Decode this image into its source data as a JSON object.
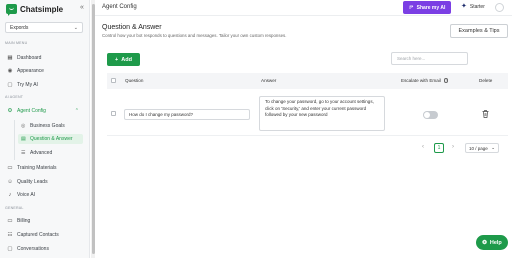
{
  "app": {
    "name": "Chatsimple",
    "brand_color": "#1e9a4a",
    "accent_color": "#7b3fe4"
  },
  "sidebar": {
    "workspace": "Expords",
    "sections": {
      "main_menu": "MAIN MENU",
      "ai_agent": "AI AGENT",
      "general": "GENERAL"
    },
    "main_items": [
      {
        "label": "Dashboard",
        "icon": "grid-icon"
      },
      {
        "label": "Appearance",
        "icon": "eye-icon"
      },
      {
        "label": "Try My AI",
        "icon": "chat-icon"
      }
    ],
    "agent_config": {
      "label": "Agent Config",
      "icon": "gear-icon",
      "expanded": true
    },
    "agent_sub_items": [
      {
        "label": "Business Goals",
        "icon": "target-icon",
        "active": false
      },
      {
        "label": "Question & Answer",
        "icon": "qa-icon",
        "active": true
      },
      {
        "label": "Advanced",
        "icon": "sliders-icon",
        "active": false
      }
    ],
    "agent_items": [
      {
        "label": "Training Materials",
        "icon": "book-icon"
      },
      {
        "label": "Quality Leads",
        "icon": "users-icon"
      },
      {
        "label": "Voice AI",
        "icon": "mic-icon"
      }
    ],
    "general_items": [
      {
        "label": "Billing",
        "icon": "card-icon"
      },
      {
        "label": "Captured Contacts",
        "icon": "contacts-icon"
      },
      {
        "label": "Conversations",
        "icon": "conversation-icon"
      }
    ]
  },
  "topbar": {
    "title": "Agent Config",
    "share_label": "Share my AI",
    "plan_label": "Starter"
  },
  "main": {
    "title": "Question & Answer",
    "description": "Control how your bot responds to questions and messages. Tailor your own custom responses.",
    "tips_label": "Examples & Tips",
    "add_label": "Add",
    "search_placeholder": "Search here...",
    "columns": {
      "question": "Question",
      "answer": "Answer",
      "escalate": "Escalate with Email",
      "delete": "Delete"
    },
    "rows": [
      {
        "question": "How do I change my password?",
        "answer": "To change your password, go to your account settings, click on 'Security,' and enter your current password followed by your new password",
        "escalate": false
      }
    ],
    "pagination": {
      "current_page": "1",
      "page_size": "10 / page"
    }
  },
  "help_label": "Help"
}
